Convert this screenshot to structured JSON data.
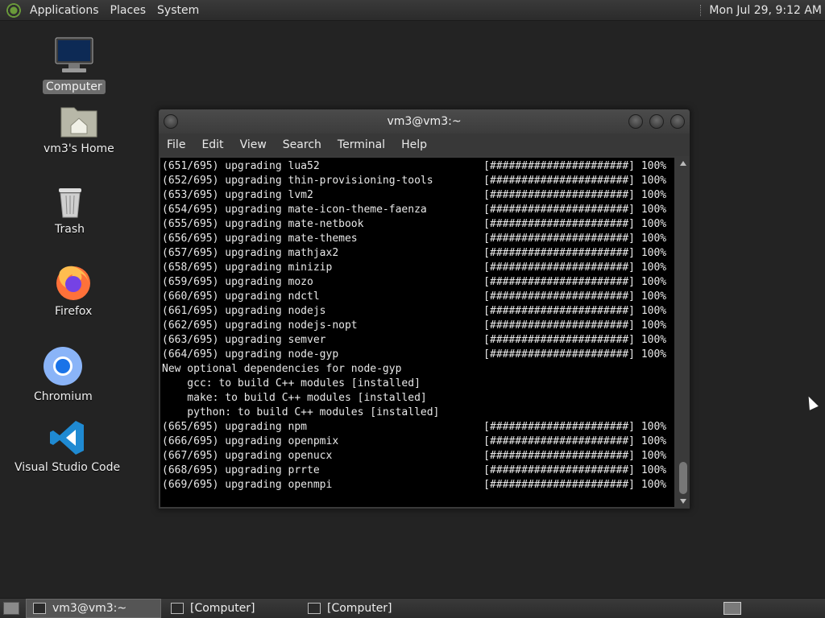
{
  "top_panel": {
    "menus": [
      "Applications",
      "Places",
      "System"
    ],
    "clock": "Mon Jul 29,  9:12 AM"
  },
  "desktop_icons": [
    {
      "label": "Computer",
      "icon": "computer-icon"
    },
    {
      "label": "vm3's Home",
      "icon": "home-folder-icon"
    },
    {
      "label": "Trash",
      "icon": "trash-icon"
    },
    {
      "label": "Firefox",
      "icon": "firefox-icon"
    },
    {
      "label": "Chromium",
      "icon": "chromium-icon"
    },
    {
      "label": "Visual Studio Code",
      "icon": "vscode-icon"
    }
  ],
  "terminal": {
    "title": "vm3@vm3:~",
    "menus": [
      "File",
      "Edit",
      "View",
      "Search",
      "Terminal",
      "Help"
    ],
    "lines": [
      "(651/695) upgrading lua52                          [######################] 100%",
      "(652/695) upgrading thin-provisioning-tools        [######################] 100%",
      "(653/695) upgrading lvm2                           [######################] 100%",
      "(654/695) upgrading mate-icon-theme-faenza         [######################] 100%",
      "(655/695) upgrading mate-netbook                   [######################] 100%",
      "(656/695) upgrading mate-themes                    [######################] 100%",
      "(657/695) upgrading mathjax2                       [######################] 100%",
      "(658/695) upgrading minizip                        [######################] 100%",
      "(659/695) upgrading mozo                           [######################] 100%",
      "(660/695) upgrading ndctl                          [######################] 100%",
      "(661/695) upgrading nodejs                         [######################] 100%",
      "(662/695) upgrading nodejs-nopt                    [######################] 100%",
      "(663/695) upgrading semver                         [######################] 100%",
      "(664/695) upgrading node-gyp                       [######################] 100%",
      "New optional dependencies for node-gyp",
      "    gcc: to build C++ modules [installed]",
      "    make: to build C++ modules [installed]",
      "    python: to build C++ modules [installed]",
      "(665/695) upgrading npm                            [######################] 100%",
      "(666/695) upgrading openpmix                       [######################] 100%",
      "(667/695) upgrading openucx                        [######################] 100%",
      "(668/695) upgrading prrte                          [######################] 100%",
      "(669/695) upgrading openmpi                        [######################] 100%"
    ]
  },
  "taskbar": {
    "tasks": [
      {
        "label": "vm3@vm3:~",
        "active": true
      },
      {
        "label": "[Computer]",
        "active": false
      },
      {
        "label": "[Computer]",
        "active": false
      }
    ]
  }
}
